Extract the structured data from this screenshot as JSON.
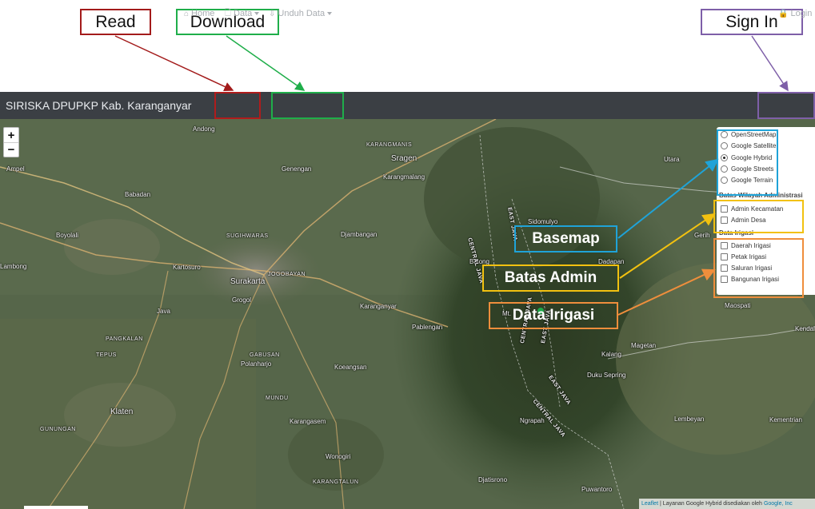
{
  "callouts": {
    "read": "Read",
    "download": "Download",
    "sign_in": "Sign In"
  },
  "navbar": {
    "brand": "SIRISKA DPUPKP Kab. Karanganyar",
    "home": "Home",
    "data": "Data",
    "unduh": "Unduh Data",
    "login": "Login"
  },
  "zoom": {
    "in": "+",
    "out": "−"
  },
  "layers": {
    "basemaps": [
      {
        "label": "OpenStreetMap",
        "selected": false
      },
      {
        "label": "Google Satellite",
        "selected": false
      },
      {
        "label": "Google Hybrid",
        "selected": true
      },
      {
        "label": "Google Streets",
        "selected": false
      },
      {
        "label": "Google Terrain",
        "selected": false
      }
    ],
    "batas_title": "Batas Wilayah Administrasi",
    "batas": [
      {
        "label": "Admin Kecamatan",
        "checked": false
      },
      {
        "label": "Admin Desa",
        "checked": false
      }
    ],
    "irigasi_title": "Data Irigasi",
    "irigasi": [
      {
        "label": "Daerah Irigasi",
        "checked": false
      },
      {
        "label": "Petak Irigasi",
        "checked": false
      },
      {
        "label": "Saluran Irigasi",
        "checked": false
      },
      {
        "label": "Bangunan Irigasi",
        "checked": false
      }
    ]
  },
  "annotations": {
    "basemap": "Basemap",
    "batas_admin": "Batas Admin",
    "data_irigasi": "Data Irigasi"
  },
  "map_labels": {
    "andong": "Andong",
    "karangmanis": "KARANGMANIS",
    "sragen": "Sragen",
    "karangmalang": "Karangmalang",
    "genengan": "Genengan",
    "ampel": "Ampel",
    "babadan": "Babadan",
    "boyolali": "Boyolali",
    "sugihwaras": "SUGIHWARAS",
    "djambangan": "Djambangan",
    "lambong": "Lambong",
    "kartosuro": "Kartosuro",
    "jogobayan": "JOGOBAYAN",
    "surakarta": "Surakarta",
    "grogol": "Grogol",
    "java": "Java",
    "karanganyar": "Karanganyar",
    "pangkalan": "PANGKALAN",
    "tepus": "TEPUS",
    "pablengan": "Pablengan",
    "gabusan": "GABUSAN",
    "polanharjo": "Polanharjo",
    "koeangsan": "Koeangsan",
    "mundu": "MUNDU",
    "klaten": "Klaten",
    "karangasem": "Karangasem",
    "gunungan": "GUNUNGAN",
    "wonogiri": "Wonogiri",
    "karangtalun": "KARANGTALUN",
    "djatisrono": "Djatisrono",
    "puwantoro": "Puwantoro",
    "sidomulyo": "Sidomulyo",
    "balong": "Balong",
    "dadapan": "Dadapan",
    "mt": "Mt.",
    "utara": "Utara",
    "gerih": "Gerih",
    "maospati": "Maospati",
    "magetan": "Magetan",
    "kalang": "Kalang",
    "duku_sepring": "Duku\nSepring",
    "ngrapah": "Ngrapah",
    "lembeyan": "Lembeyan",
    "kendal": "Kendal",
    "kementrian": "Kementrian",
    "central_java": "CENTRAL JAVA",
    "east_java": "EAST JAVA"
  },
  "attribution": {
    "leaflet": "Leaflet",
    "text": "| Layanan Google Hybrid disediakan oleh",
    "google": "Google, Inc"
  },
  "colors": {
    "navbar": "#3b3f44",
    "read": "#a31b1b",
    "download": "#1fae4a",
    "signin": "#7e5fa8",
    "basemap": "#1fa3d8",
    "batas": "#f2c110",
    "irigasi": "#ef8e3c"
  }
}
